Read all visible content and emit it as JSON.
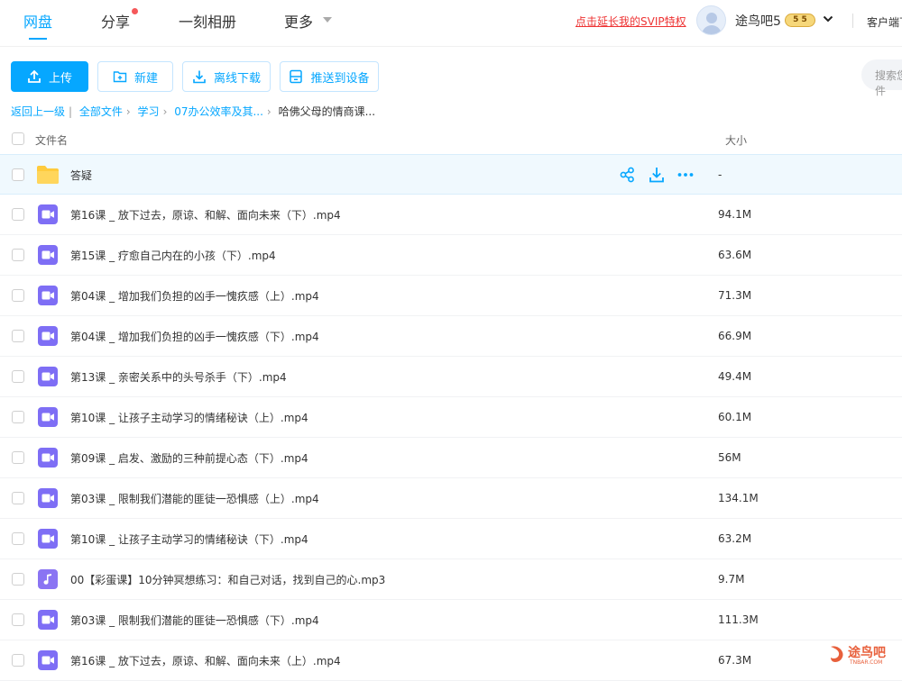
{
  "nav": {
    "items": [
      {
        "label": "网盘",
        "active": true
      },
      {
        "label": "分享",
        "active": false
      },
      {
        "label": "一刻相册",
        "active": false
      },
      {
        "label": "更多",
        "active": false
      }
    ]
  },
  "header": {
    "svip_link": "点击延长我的SVIP特权",
    "username": "途鸟吧5",
    "vip_level": "5 5",
    "client_link": "客户端下载"
  },
  "toolbar": {
    "upload": "上传",
    "new": "新建",
    "offline_download": "离线下载",
    "push_to_device": "推送到设备",
    "search_placeholder": "搜索您的文件"
  },
  "breadcrumb": {
    "back": "返回上一级",
    "sep": "|",
    "items": [
      "全部文件",
      "学习",
      "07办公效率及其..."
    ],
    "current": "哈佛父母的情商课..."
  },
  "columns": {
    "name": "文件名",
    "size": "大小"
  },
  "files": [
    {
      "name": "答疑",
      "size": "-",
      "type": "folder"
    },
    {
      "name": "第16课 _ 放下过去，原谅、和解、面向未来（下）.mp4",
      "size": "94.1M",
      "type": "video"
    },
    {
      "name": "第15课 _ 疗愈自己内在的小孩（下）.mp4",
      "size": "63.6M",
      "type": "video"
    },
    {
      "name": "第04课 _ 增加我们负担的凶手一愧疚感（上）.mp4",
      "size": "71.3M",
      "type": "video"
    },
    {
      "name": "第04课 _ 增加我们负担的凶手一愧疚感（下）.mp4",
      "size": "66.9M",
      "type": "video"
    },
    {
      "name": "第13课 _ 亲密关系中的头号杀手（下）.mp4",
      "size": "49.4M",
      "type": "video"
    },
    {
      "name": "第10课 _ 让孩子主动学习的情绪秘诀（上）.mp4",
      "size": "60.1M",
      "type": "video"
    },
    {
      "name": "第09课 _ 启发、激励的三种前提心态（下）.mp4",
      "size": "56M",
      "type": "video"
    },
    {
      "name": "第03课 _ 限制我们潜能的匪徒一恐惧感（上）.mp4",
      "size": "134.1M",
      "type": "video"
    },
    {
      "name": "第10课 _ 让孩子主动学习的情绪秘诀（下）.mp4",
      "size": "63.2M",
      "type": "video"
    },
    {
      "name": "00【彩蛋课】10分钟冥想练习：和自己对话，找到自己的心.mp3",
      "size": "9.7M",
      "type": "audio"
    },
    {
      "name": "第03课 _ 限制我们潜能的匪徒一恐惧感（下）.mp4",
      "size": "111.3M",
      "type": "video"
    },
    {
      "name": "第16课 _ 放下过去，原谅、和解、面向未来（上）.mp4",
      "size": "67.3M",
      "type": "video"
    }
  ],
  "watermark": {
    "text": "途鸟吧",
    "sub": "TNBAR.COM"
  },
  "colors": {
    "accent": "#06a7ff",
    "video_icon": "#7e6ef5",
    "folder": "#ffcb3d",
    "svip": "#e33333"
  }
}
